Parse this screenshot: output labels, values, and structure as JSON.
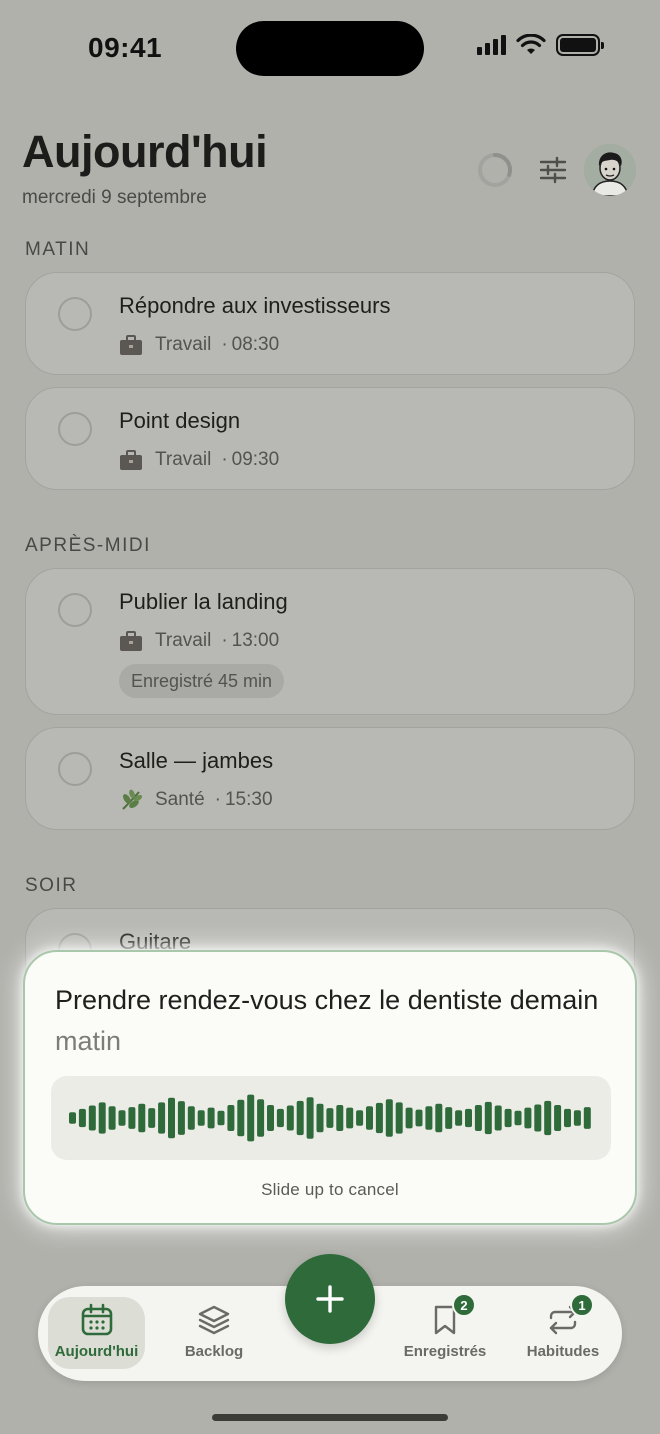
{
  "status_bar": {
    "time": "09:41"
  },
  "header": {
    "title": "Aujourd'hui",
    "date": "mercredi 9 septembre",
    "day_progress": 0.3
  },
  "sections": [
    {
      "heading": "MATIN",
      "tasks": [
        {
          "title": "Répondre aux investisseurs",
          "category_icon": "briefcase-icon",
          "category": "Travail",
          "time": "08:30"
        },
        {
          "title": "Point design",
          "category_icon": "briefcase-icon",
          "category": "Travail",
          "time": "09:30"
        }
      ]
    },
    {
      "heading": "APRÈS-MIDI",
      "tasks": [
        {
          "title": "Publier la landing",
          "category_icon": "briefcase-icon",
          "category": "Travail",
          "time": "13:00",
          "pill": "Enregistré 45 min"
        },
        {
          "title": "Salle — jambes",
          "category_icon": "herb-icon",
          "category": "Santé",
          "time": "15:30"
        }
      ]
    },
    {
      "heading": "SOIR",
      "tasks": [
        {
          "title": "Guitare"
        }
      ]
    }
  ],
  "voice": {
    "transcript_confirmed": "Prendre rendez-vous chez le dentiste demain",
    "transcript_pending": "matin",
    "cancel_hint": "Slide up to cancel",
    "accent_color": "#2e6a3a",
    "levels": [
      0.22,
      0.35,
      0.48,
      0.6,
      0.45,
      0.3,
      0.42,
      0.55,
      0.38,
      0.6,
      0.78,
      0.65,
      0.45,
      0.3,
      0.4,
      0.28,
      0.5,
      0.7,
      0.9,
      0.72,
      0.5,
      0.35,
      0.48,
      0.66,
      0.8,
      0.55,
      0.38,
      0.5,
      0.4,
      0.3,
      0.45,
      0.58,
      0.72,
      0.6,
      0.4,
      0.32,
      0.45,
      0.55,
      0.42,
      0.3,
      0.35,
      0.5,
      0.62,
      0.48,
      0.35,
      0.28,
      0.4,
      0.52,
      0.66,
      0.5,
      0.35,
      0.3,
      0.42
    ]
  },
  "nav": {
    "tabs": [
      {
        "label": "Aujourd'hui",
        "icon": "calendar-icon",
        "active": true
      },
      {
        "label": "Backlog",
        "icon": "layers-icon",
        "active": false
      },
      {
        "label": "Enregistrés",
        "icon": "bookmark-icon",
        "badge": "2",
        "active": false
      },
      {
        "label": "Habitudes",
        "icon": "repeat-icon",
        "badge": "1",
        "active": false
      }
    ],
    "add_icon": "plus-icon"
  }
}
